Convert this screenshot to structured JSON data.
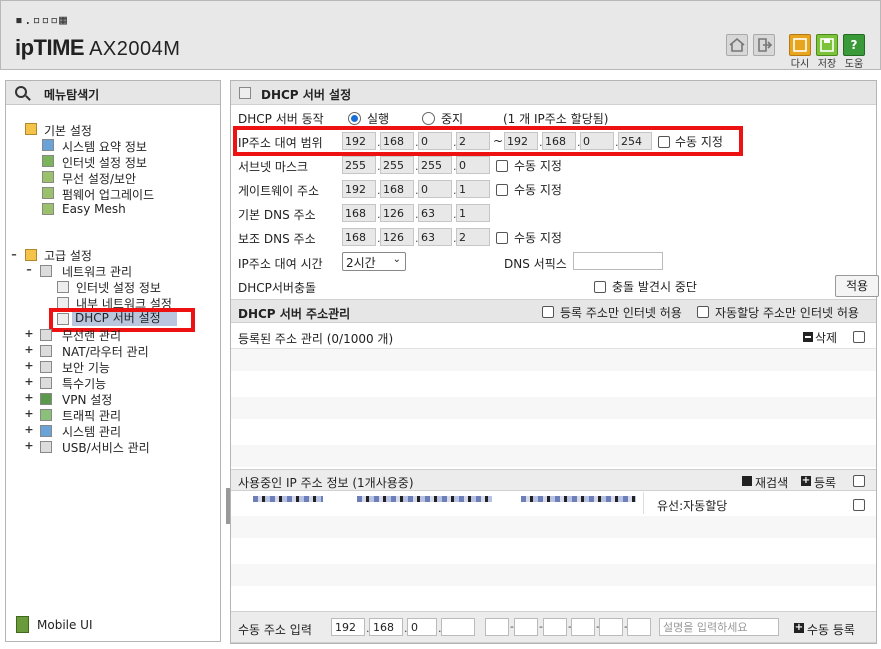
{
  "header": {
    "logo_dots": "▪.▫▫▫▦",
    "brand": "ipTIME",
    "model": "AX2004M",
    "buttons": [
      {
        "icon": "home-icon",
        "label": ""
      },
      {
        "icon": "logout-icon",
        "label": ""
      },
      {
        "icon": "undo-icon",
        "label": "다시"
      },
      {
        "icon": "save-icon",
        "label": "저장"
      },
      {
        "icon": "help-icon",
        "label": "도움"
      }
    ]
  },
  "menu": {
    "title": "메뉴탐색기",
    "basic": {
      "label": "기본 설정",
      "items": [
        "시스템 요약 정보",
        "인터넷 설정 정보",
        "무선 설정/보안",
        "펌웨어 업그레이드",
        "Easy Mesh"
      ]
    },
    "advanced": {
      "label": "고급 설정",
      "network": {
        "label": "네트워크 관리",
        "items": [
          "인터넷 설정 정보",
          "내부 네트워크 설정",
          "DHCP 서버 설정"
        ]
      },
      "groups": [
        "무선랜 관리",
        "NAT/라우터 관리",
        "보안 기능",
        "특수기능",
        "VPN 설정",
        "트래픽 관리",
        "시스템 관리",
        "USB/서비스 관리"
      ]
    },
    "mobile": "Mobile UI"
  },
  "dhcp": {
    "title": "DHCP 서버 설정",
    "operation": {
      "label": "DHCP 서버 동작",
      "run": "실행",
      "stop": "중지",
      "note": "(1 개 IP주소 할당됨)"
    },
    "range": {
      "label": "IP주소 대여 범위",
      "start": [
        "192",
        "168",
        "0",
        "2"
      ],
      "tilde": "~",
      "end": [
        "192",
        "168",
        "0",
        "254"
      ],
      "manual": "수동 지정"
    },
    "subnet": {
      "label": "서브넷 마스크",
      "values": [
        "255",
        "255",
        "255",
        "0"
      ],
      "manual": "수동 지정"
    },
    "gateway": {
      "label": "게이트웨이 주소",
      "values": [
        "192",
        "168",
        "0",
        "1"
      ],
      "manual": "수동 지정"
    },
    "dns1": {
      "label": "기본 DNS 주소",
      "values": [
        "168",
        "126",
        "63",
        "1"
      ]
    },
    "dns2": {
      "label": "보조 DNS 주소",
      "values": [
        "168",
        "126",
        "63",
        "2"
      ],
      "manual": "수동 지정"
    },
    "lease": {
      "label": "IP주소 대여 시간",
      "value": "2시간",
      "dns_suffix_label": "DNS 서픽스",
      "dns_suffix_value": ""
    },
    "conflict": {
      "label": "DHCP서버충돌",
      "stop_label": "충돌 발견시 중단",
      "apply": "적용"
    },
    "addr_mgmt": {
      "label": "DHCP 서버 주소관리",
      "reg_only": "등록 주소만 인터넷 허용",
      "auto_only": "자동할당 주소만 인터넷 허용"
    },
    "registered": {
      "label": "등록된 주소 관리 (0/1000 개)",
      "delete": "삭제"
    },
    "in_use": {
      "label": "사용중인 IP 주소 정보 (1개사용중)",
      "rescan": "재검색",
      "register": "등록",
      "row_type": "유선:자동할당"
    },
    "manual_input": {
      "label": "수동 주소 입력",
      "ip": [
        "192",
        "168",
        "0",
        ""
      ],
      "desc_placeholder": "설명을 입력하세요",
      "register": "수동 등록"
    }
  },
  "colors": {
    "highlight": "#e11111",
    "selected": "#b9c6dd",
    "panel_header": "#e6e6e6"
  }
}
